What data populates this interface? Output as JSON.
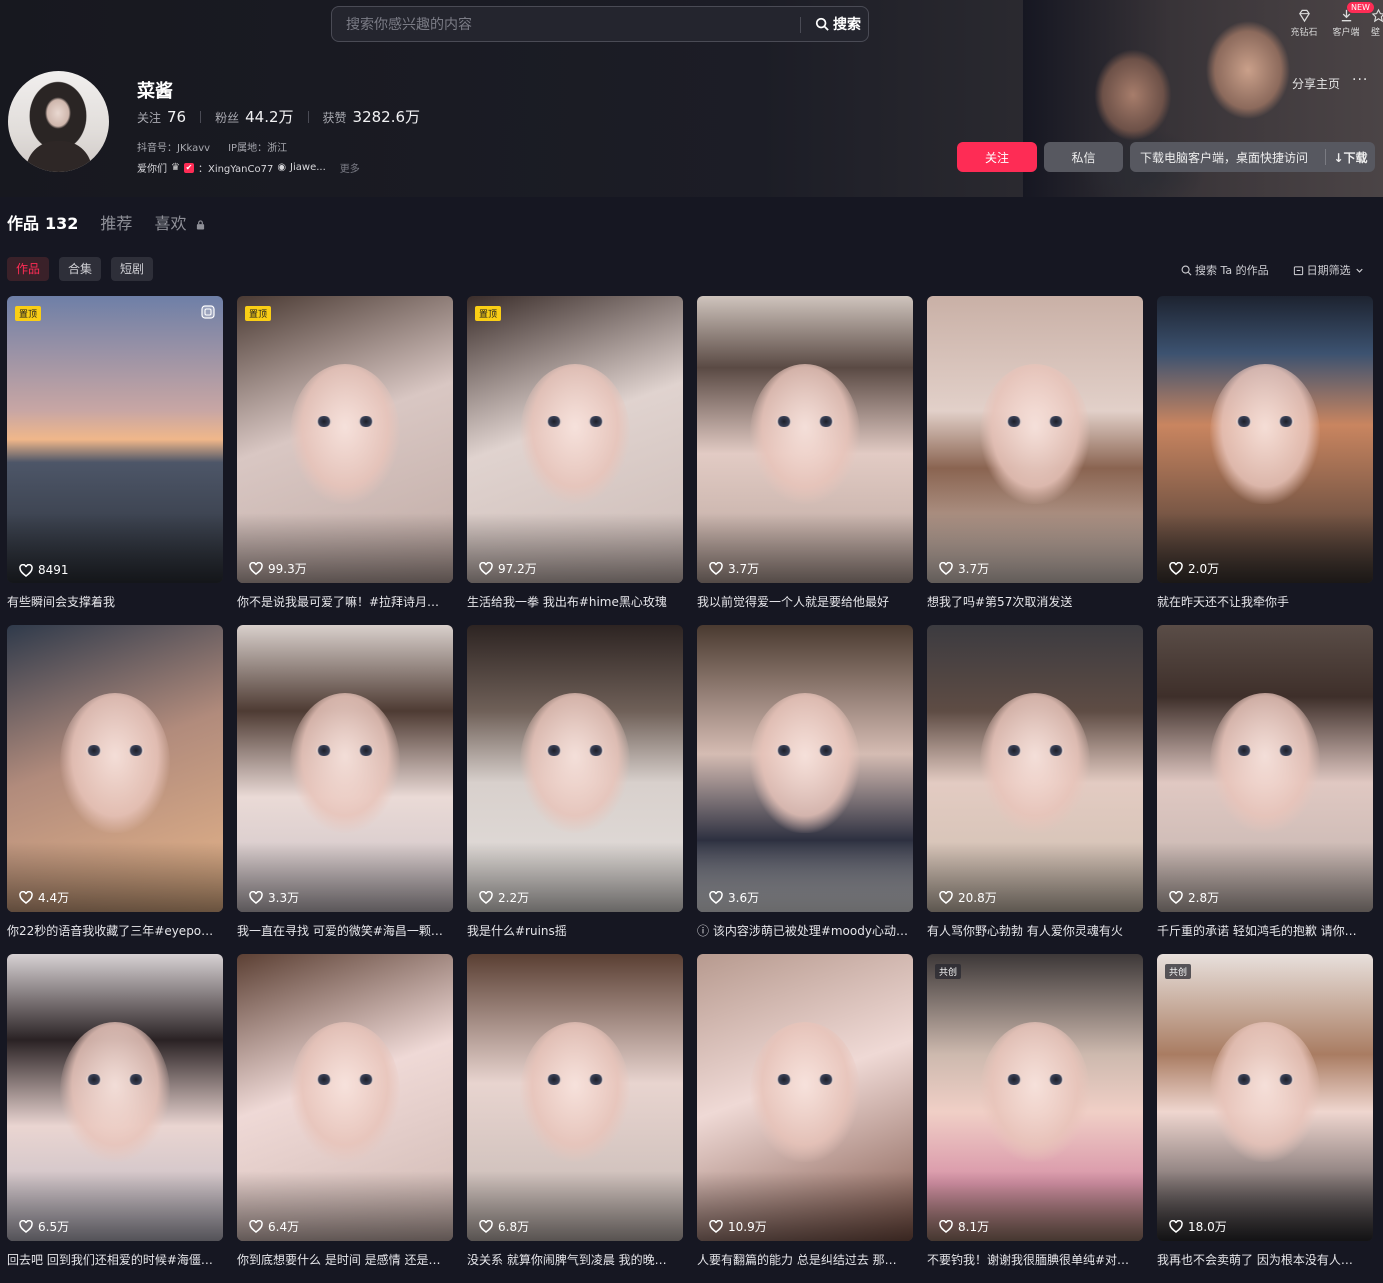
{
  "search": {
    "placeholder": "搜索你感兴趣的内容",
    "button": "搜索"
  },
  "top_tools": [
    {
      "label": "充钻石",
      "icon": "diamond-icon"
    },
    {
      "label": "客户端",
      "icon": "download-icon",
      "badge": "NEW"
    },
    {
      "label": "壁",
      "icon": "wallpaper-icon"
    }
  ],
  "profile": {
    "nickname": "菜酱",
    "stats": [
      {
        "label": "关注",
        "value": "76"
      },
      {
        "label": "粉丝",
        "value": "44.2万"
      },
      {
        "label": "获赞",
        "value": "3282.6万"
      }
    ],
    "douyin_id": "抖音号：JKkavv",
    "ip": "IP属地：浙江",
    "bio_prefix": "爱你们",
    "bio_tag": "✔",
    "bio_text": "：XingYanCo77",
    "bio_link": "Jiawe...",
    "bio_more": "更多"
  },
  "actions": {
    "share": "分享主页",
    "more": "···",
    "follow": "关注",
    "message": "私信",
    "download_text": "下载电脑客户端，桌面快捷访问",
    "download_btn": "↓下载"
  },
  "tabs": [
    {
      "label": "作品",
      "count": "132",
      "active": true
    },
    {
      "label": "推荐",
      "count": ""
    },
    {
      "label": "喜欢",
      "count": "",
      "locked": true
    }
  ],
  "subtabs": [
    "作品",
    "合集",
    "短剧"
  ],
  "right_tools": {
    "search_works": "搜索 Ta 的作品",
    "date_filter": "日期筛选"
  },
  "videos": [
    {
      "title": "有些瞬间会支撑着我",
      "likes": "8491",
      "badge": "置顶",
      "multi": true,
      "bg": "linear-gradient(180deg,#6e7fa7 0%,#c8a6a4 40%,#f0b78a 50%,#4d5668 58%,#2c3038 100%)",
      "face": false
    },
    {
      "title": "你不是说我最可爱了嘛！#拉拜诗月…",
      "likes": "99.3万",
      "badge": "置顶",
      "bg": "linear-gradient(160deg,#4a3a33 0%,#d9c7c3 45%,#bfaaa4 100%)",
      "face": true
    },
    {
      "title": "生活给我一拳 我出布#hime黑心玫瑰",
      "likes": "97.2万",
      "badge": "置顶",
      "bg": "linear-gradient(160deg,#3a2d2a 0%,#e0d3cf 45%,#cbbab5 100%)",
      "face": true
    },
    {
      "title": "我以前觉得爱一个人就是要给他最好",
      "likes": "3.7万",
      "bg": "linear-gradient(180deg,#cfc4bd 0%,#5a4a44 25%,#e2cbc4 55%,#b8a49c 100%)",
      "face": true
    },
    {
      "title": "想我了吗#第57次取消发送",
      "likes": "3.7万",
      "bg": "linear-gradient(180deg,#c9b0a6 0%,#e2d0c9 40%,#8a6451 60%,#d8cbc4 100%)",
      "face": true
    },
    {
      "title": "就在昨天还不让我牵你手",
      "likes": "2.0万",
      "bg": "linear-gradient(180deg,#1d2330 0%,#3c5270 20%,#c98560 45%,#3b3431 100%)",
      "face": true
    },
    {
      "title": "你22秒的语音我收藏了三年#eyepo…",
      "likes": "4.4万",
      "bg": "linear-gradient(160deg,#2f3a4b 0%,#b18b7c 45%,#e8b68a 100%)",
      "face": true
    },
    {
      "title": "我一直在寻找 可爱的微笑#海昌一颗…",
      "likes": "3.3万",
      "bg": "linear-gradient(180deg,#d9d0cc 0%,#4e3b33 30%,#eadad6 60%,#c9c0c5 100%)",
      "face": true
    },
    {
      "title": "我是什么#ruins摇",
      "likes": "2.2万",
      "bg": "linear-gradient(180deg,#2d2422 0%,#6f6058 30%,#d8d0cc 55%,#e4e0dd 100%)",
      "face": true
    },
    {
      "title": "ⓘ 该内容涉萌已被处理#moody心动…",
      "likes": "3.6万",
      "bg": "linear-gradient(180deg,#4a3a30 0%,#d5bcb3 45%,#2d3040 75%,#e6e6ea 100%)",
      "face": true
    },
    {
      "title": "有人骂你野心勃勃 有人爱你灵魂有火",
      "likes": "20.8万",
      "bg": "linear-gradient(180deg,#3c3b40 0%,#5e4c44 30%,#e3cbc2 55%,#cdbfb0 100%)",
      "face": true
    },
    {
      "title": "千斤重的承诺 轻如鸿毛的抱歉 请你…",
      "likes": "2.8万",
      "bg": "linear-gradient(180deg,#5a4d47 0%,#3e2f2a 25%,#e0c8c2 55%,#bfb2ad 100%)",
      "face": true
    },
    {
      "title": "回去吧 回到我们还相爱的时候#海僵…",
      "likes": "6.5万",
      "bg": "linear-gradient(180deg,#d7d1d3 0%,#2a2224 30%,#ead5d1 60%,#b9b6c2 100%)",
      "face": true
    },
    {
      "title": "你到底想要什么 是时间 是感情 还是…",
      "likes": "6.4万",
      "bg": "linear-gradient(160deg,#5c4034 0%,#efd9d6 45%,#cdb7b1 100%)",
      "face": true
    },
    {
      "title": "没关系 就算你闹脾气到凌晨 我的晚…",
      "likes": "6.8万",
      "bg": "linear-gradient(180deg,#5a3f33 0%,#e8d4cf 45%,#c2b7b2 100%)",
      "face": true
    },
    {
      "title": "人要有翻篇的能力 总是纠结过去 那…",
      "likes": "10.9万",
      "bg": "linear-gradient(160deg,#b79a8f 0%,#efd9d5 45%,#7c5347 100%)",
      "face": true
    },
    {
      "title": "不要钓我！谢谢我很腼腆很单纯#对…",
      "likes": "8.1万",
      "badge": "共创",
      "co": true,
      "bg": "linear-gradient(180deg,#3d3838 0%,#cdb9ae 35%,#f0cfc6 55%,#d894a8 80%,#9a7a6b 100%)",
      "face": true
    },
    {
      "title": "我再也不会卖萌了 因为根本没有人…",
      "likes": "18.0万",
      "badge": "共创",
      "co": true,
      "bg": "linear-gradient(180deg,#e8e0dc 0%,#a97c62 35%,#efd6cf 55%,#2b2a2e 100%)",
      "face": true
    }
  ],
  "colors": {
    "accent": "#fe2c55",
    "background": "#161722",
    "pin": "#face15"
  }
}
